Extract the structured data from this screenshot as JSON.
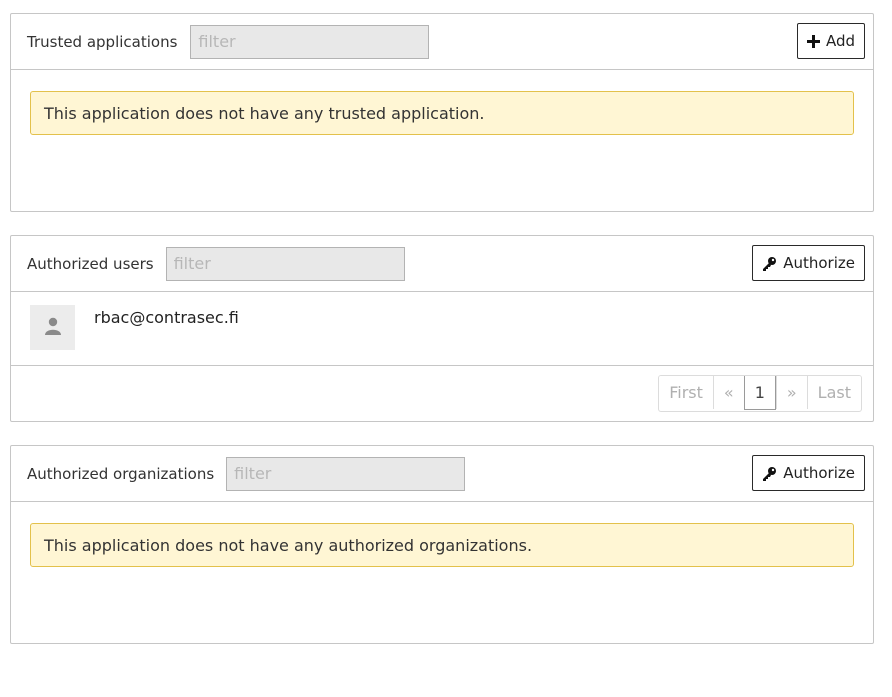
{
  "trusted_apps": {
    "title": "Trusted applications",
    "filter_placeholder": "filter",
    "add_label": "Add",
    "empty_message": "This application does not have any trusted application."
  },
  "authorized_users": {
    "title": "Authorized users",
    "filter_placeholder": "filter",
    "authorize_label": "Authorize",
    "users": [
      {
        "email": "rbac@contrasec.fi",
        "avatar_icon": "user-icon"
      }
    ],
    "pagination": {
      "first": "First",
      "prev": "«",
      "current": "1",
      "next": "»",
      "last": "Last"
    }
  },
  "authorized_orgs": {
    "title": "Authorized organizations",
    "filter_placeholder": "filter",
    "authorize_label": "Authorize",
    "empty_message": "This application does not have any authorized organizations."
  },
  "colors": {
    "alert_bg": "#fff6d4",
    "alert_border": "#e3c14b",
    "panel_border": "#c6c6c6",
    "input_bg": "#e8e8e8"
  }
}
